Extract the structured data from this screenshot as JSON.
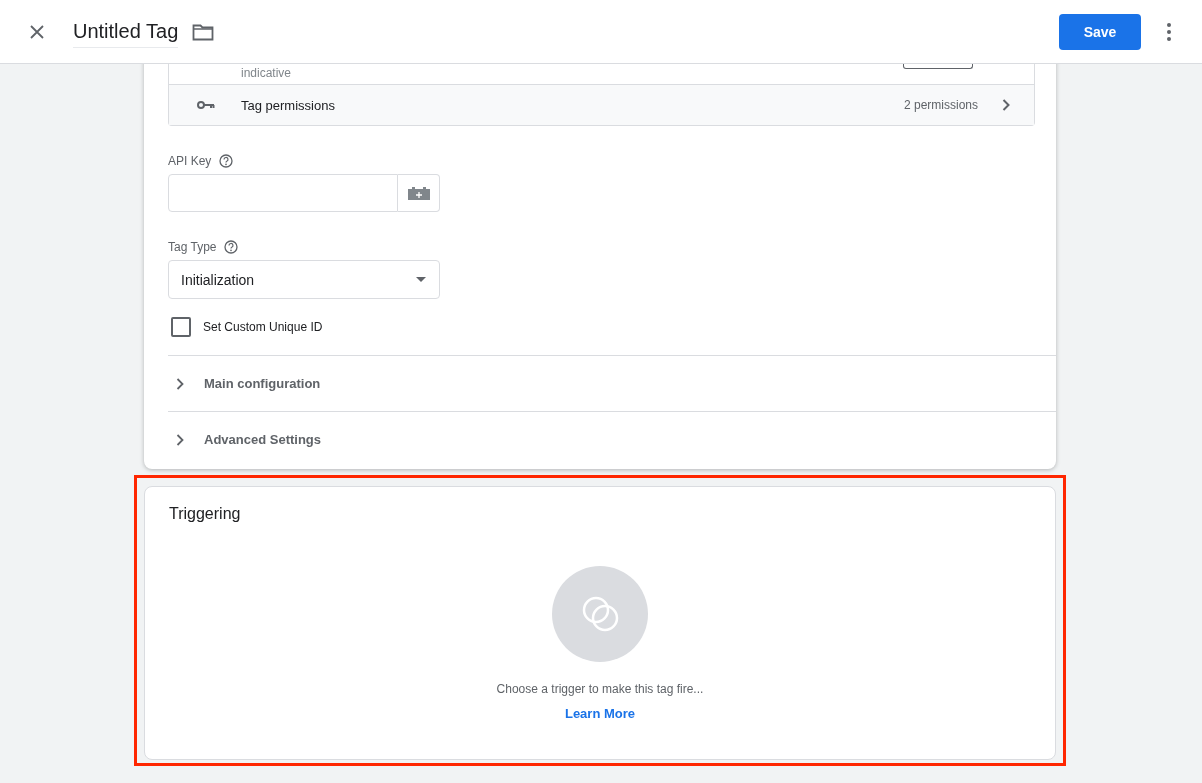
{
  "header": {
    "title": "Untitled Tag",
    "save": "Save"
  },
  "config": {
    "cut_row": "indicative",
    "permissions": {
      "label": "Tag permissions",
      "count": "2 permissions"
    },
    "api_key": {
      "label": "API Key"
    },
    "tag_type": {
      "label": "Tag Type",
      "value": "Initialization"
    },
    "custom_id": {
      "label": "Set Custom Unique ID",
      "checked": false
    },
    "sections": [
      {
        "label": "Main configuration",
        "expanded": false
      },
      {
        "label": "Advanced Settings",
        "expanded": false
      }
    ]
  },
  "triggering": {
    "title": "Triggering",
    "message": "Choose a trigger to make this tag fire...",
    "link": "Learn More",
    "highlighted": true
  }
}
